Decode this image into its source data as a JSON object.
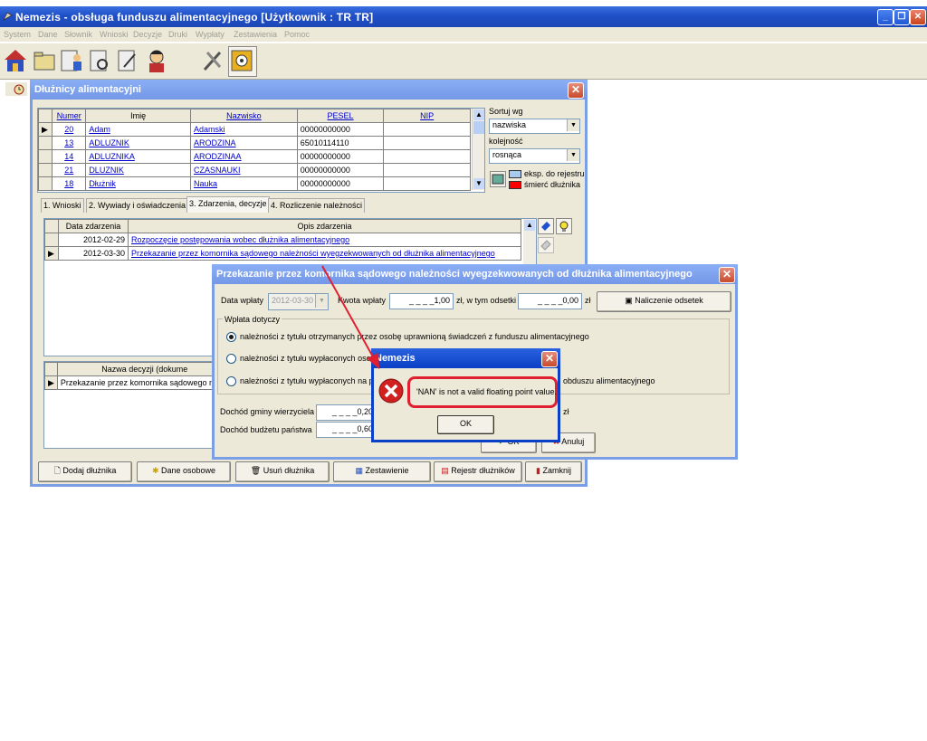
{
  "app": {
    "title": "Nemezis - obsługa funduszu alimentacyjnego  [Użytkownik : TR TR]"
  },
  "menu": [
    "System",
    "Dane",
    "Słownik",
    "Wnioski",
    "Decyzje",
    "Druki",
    "Wypłaty",
    "Zestawienia",
    "Pomoc"
  ],
  "toolbar_icons": [
    "home-icon",
    "folder-icon",
    "user-folder-icon",
    "document-search-icon",
    "document-edit-icon",
    "person-icon",
    "tools-icon",
    "safe-icon"
  ],
  "dluznicy": {
    "title": "Dłużnicy alimentacyjni",
    "columns": [
      "Numer",
      "Imię",
      "Nazwisko",
      "PESEL",
      "NIP"
    ],
    "rows": [
      {
        "numer": "20",
        "imie": "Adam",
        "nazwisko": "Adamski",
        "pesel": "00000000000",
        "nip": ""
      },
      {
        "numer": "13",
        "imie": "ADLUZNIK",
        "nazwisko": "ARODZINA",
        "pesel": "65010114110",
        "nip": ""
      },
      {
        "numer": "14",
        "imie": "ADLUZNIKA",
        "nazwisko": "ARODZINAA",
        "pesel": "00000000000",
        "nip": ""
      },
      {
        "numer": "21",
        "imie": "DLUZNIK",
        "nazwisko": "CZASNAUKI",
        "pesel": "00000000000",
        "nip": ""
      },
      {
        "numer": "18",
        "imie": "Dłużnik",
        "nazwisko": "Nauka",
        "pesel": "00000000000",
        "nip": ""
      }
    ],
    "sort_label": "Sortuj wg",
    "sort_value": "nazwiska",
    "order_label": "kolejność",
    "order_value": "rosnąca",
    "legend": [
      "eksp. do rejestru",
      "śmierć dłużnika"
    ],
    "legend_colors": [
      "#a6caf0",
      "#ff0000"
    ],
    "tabs": [
      "1. Wnioski",
      "2. Wywiady i oświadczenia",
      "3. Zdarzenia, decyzje",
      "4. Rozliczenie należności"
    ],
    "events_columns": [
      "Data zdarzenia",
      "Opis zdarzenia"
    ],
    "events": [
      {
        "date": "2012-02-29",
        "desc": "Rozpoczęcie postępowania wobec dłużnika alimentacyjnego"
      },
      {
        "date": "2012-03-30",
        "desc": "Przekazanie przez komornika sądowego należności wyegzekwowanych od dłużnika alimentacyjnego"
      }
    ],
    "decisions_column": "Nazwa decyzji (dokume",
    "decision_row": "Przekazanie przez komornika sądowego naleź",
    "buttons": [
      "Dodaj dłużnika",
      "Dane osobowe",
      "Usuń dłużnika",
      "Zestawienie",
      "Rejestr dłużników",
      "Zamknij"
    ]
  },
  "przekazanie": {
    "title": "Przekazanie przez komornika sądowego należności wyegzekwowanych od dłużnika alimentacyjnego",
    "data_wplaty_label": "Data wpłaty",
    "data_wplaty": "2012-03-30",
    "kwota_label": "Kwota wpłaty",
    "kwota": "_ _ _ _1,00",
    "zl_w_tym": "zł, w tym odsetki",
    "odsetki": "_ _ _ _0,00",
    "zl": "zł",
    "naliczenie_btn": "Naliczenie odsetek",
    "group_label": "Wpłata dotyczy",
    "radio1": "należności z tytułu otrzymanych przez osobę uprawnioną świadczeń z funduszu alimentacyjnego",
    "radio2": "należności z tytułu  wypłaconych osob",
    "radio3a": "należności z tytułu  wypłaconych na p",
    "radio3b": "obduszu alimentacyjnego",
    "dochod_gminy_label": "Dochód gminy wierzyciela",
    "dochod_gminy": "_ _ _ _0,20",
    "dochod_budzetu_label": "Dochód budżetu państwa",
    "dochod_budzetu": "_ _ _ _0,60",
    "zl_right": "zł",
    "ok_btn": "OK",
    "anuluj_btn": "Anuluj"
  },
  "error_dialog": {
    "title": "Nemezis",
    "message": "'NAN' is not a valid floating point value.",
    "ok": "OK"
  }
}
